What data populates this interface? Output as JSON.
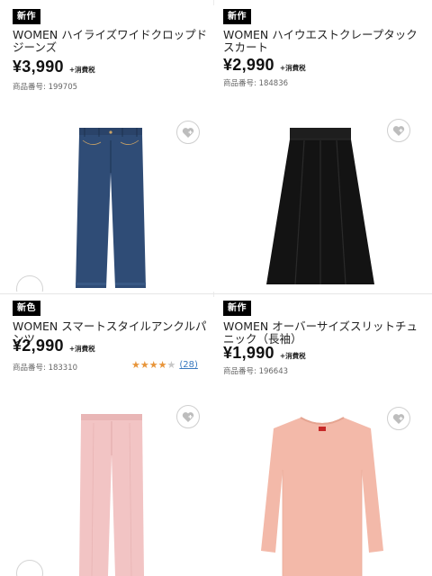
{
  "products": [
    {
      "badge": "新作",
      "name": "WOMEN ハイライズワイドクロップドジーンズ",
      "price": "¥3,990",
      "tax": "+消費税",
      "code": "商品番号: 199705",
      "image": "wide-cropped-jeans",
      "favorite_icon": "heart-plus-icon"
    },
    {
      "badge": "新作",
      "name": "WOMEN ハイウエストクレープタックスカート",
      "price": "¥2,990",
      "tax": "+消費税",
      "code": "商品番号: 184836",
      "image": "black-tuck-skirt",
      "favorite_icon": "heart-plus-icon"
    },
    {
      "badge": "新色",
      "name": "WOMEN スマートスタイルアンクルパンツ",
      "price": "¥2,990",
      "tax": "+消費税",
      "code": "商品番号: 183310",
      "rating": 4,
      "rating_max": 5,
      "review_count": "(28)",
      "image": "pink-ankle-pants",
      "favorite_icon": "heart-plus-icon"
    },
    {
      "badge": "新作",
      "name": "WOMEN オーバーサイズスリットチュニック（長袖）",
      "price": "¥1,990",
      "tax": "+消費税",
      "code": "商品番号: 196643",
      "image": "pink-slit-tunic",
      "favorite_icon": "heart-plus-icon"
    }
  ],
  "colors": {
    "badge_bg": "#000000",
    "star_on": "#e8953a",
    "star_off": "#c7c7c7",
    "link": "#3a7ac0",
    "denim": "#2e4a73",
    "skirt": "#151515",
    "pants": "#f2c4c4",
    "tunic": "#f3b9a9"
  }
}
